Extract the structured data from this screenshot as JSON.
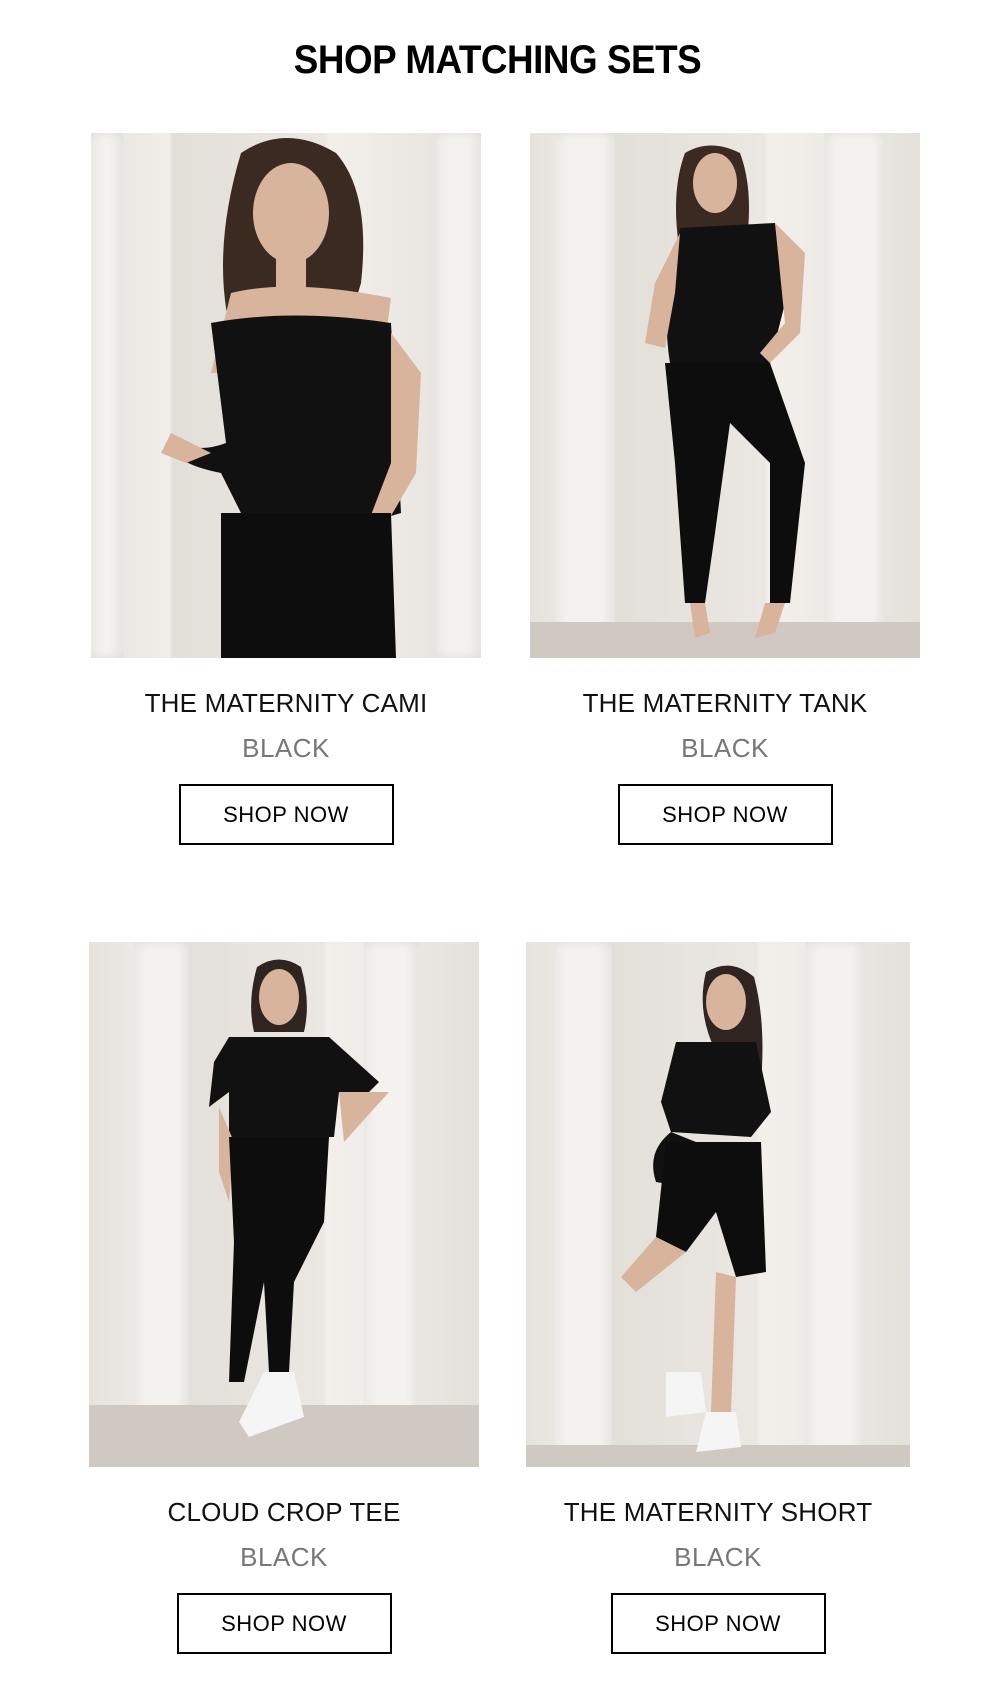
{
  "header": {
    "title": "SHOP MATCHING SETS"
  },
  "products": [
    {
      "name": "THE MATERNITY CAMI",
      "color": "BLACK",
      "cta": "SHOP NOW"
    },
    {
      "name": "THE MATERNITY TANK",
      "color": "BLACK",
      "cta": "SHOP NOW"
    },
    {
      "name": "CLOUD CROP TEE",
      "color": "BLACK",
      "cta": "SHOP NOW"
    },
    {
      "name": "THE MATERNITY SHORT",
      "color": "BLACK",
      "cta": "SHOP NOW"
    }
  ],
  "colors": {
    "text": "#000000",
    "muted": "#777777",
    "background": "#ffffff"
  }
}
